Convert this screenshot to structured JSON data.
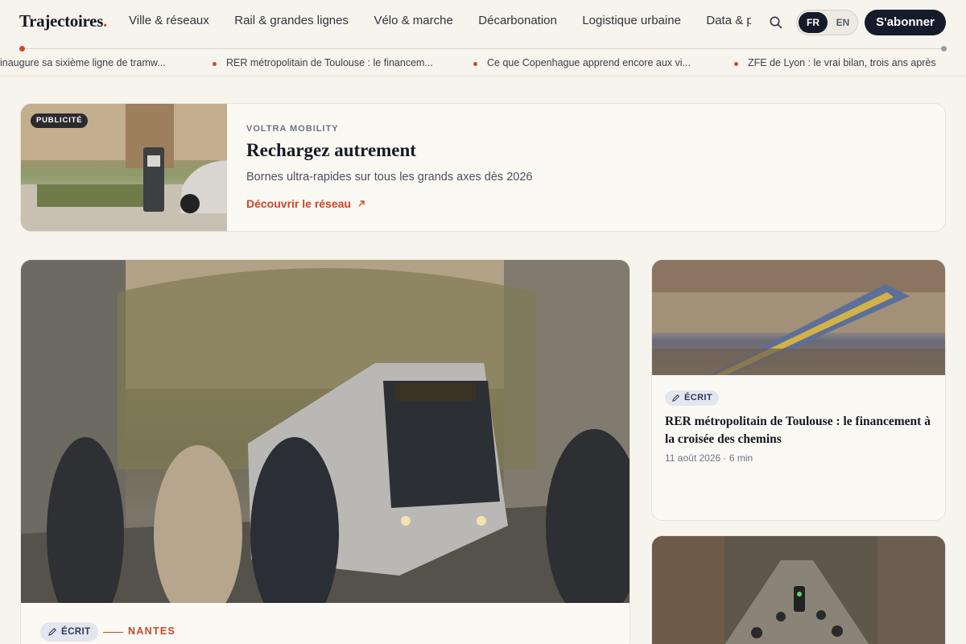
{
  "header": {
    "logo": "Trajectoires",
    "logo_dot": ".",
    "nav": [
      "Ville & réseaux",
      "Rail & grandes lignes",
      "Vélo & marche",
      "Décarbonation",
      "Logistique urbaine",
      "Data & politique"
    ],
    "lang_fr": "FR",
    "lang_en": "EN",
    "subscribe": "S'abonner",
    "icons": [
      "search-icon"
    ]
  },
  "ticker": [
    "inaugure sa sixième ligne de tramw...",
    "RER métropolitain de Toulouse : le financem...",
    "Ce que Copenhague apprend encore aux vi...",
    "ZFE de Lyon : le vrai bilan, trois ans après"
  ],
  "ad": {
    "badge": "PUBLICITÉ",
    "brand": "VOLTRA MOBILITY",
    "title": "Rechargez autrement",
    "subtitle": "Bornes ultra-rapides sur tous les grands axes dès 2026",
    "link": "Découvrir le réseau",
    "link_icon": "arrow-up-right-icon"
  },
  "hero": {
    "format": "ÉCRIT",
    "city": "NANTES",
    "image": "tram-street-photo"
  },
  "cards": [
    {
      "format": "ÉCRIT",
      "title": "RER métropolitain de Toulouse : le financement à la croisée des chemins",
      "meta": "11 août 2026 · 6 min",
      "image": "train-station-photo"
    },
    {
      "image": "cyclists-street-photo"
    }
  ],
  "colors": {
    "accent": "#d0482b",
    "navy": "#141b2b",
    "background": "#f7f4ee"
  }
}
